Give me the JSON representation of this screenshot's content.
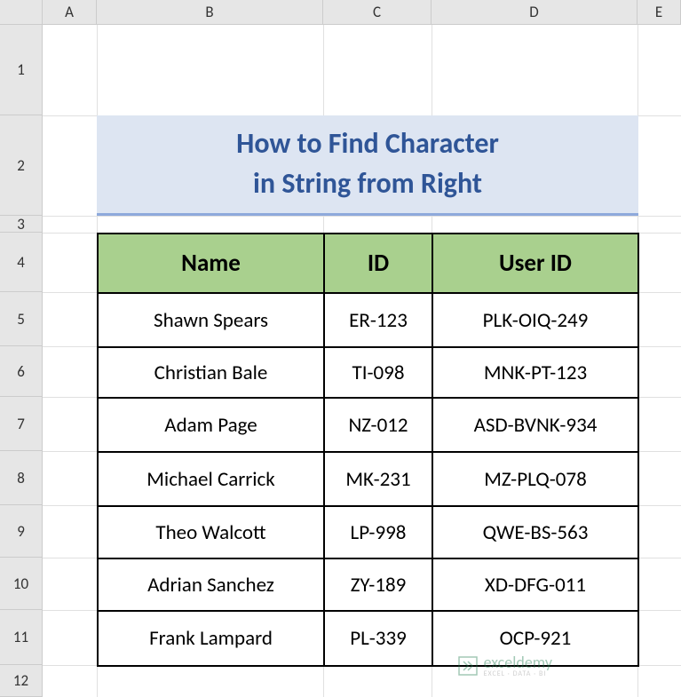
{
  "columnHeaders": {
    "A": "A",
    "B": "B",
    "C": "C",
    "D": "D",
    "E": "E"
  },
  "rowHeaders": {
    "1": "1",
    "2": "2",
    "3": "3",
    "4": "4",
    "5": "5",
    "6": "6",
    "7": "7",
    "8": "8",
    "9": "9",
    "10": "10",
    "11": "11",
    "12": "12"
  },
  "title": {
    "line1": "How to Find Character",
    "line2": "in String from Right"
  },
  "table": {
    "headers": {
      "name": "Name",
      "id": "ID",
      "userId": "User ID"
    },
    "rows": [
      {
        "name": "Shawn Spears",
        "id": "ER-123",
        "userId": "PLK-OIQ-249"
      },
      {
        "name": "Christian Bale",
        "id": "TI-098",
        "userId": "MNK-PT-123"
      },
      {
        "name": "Adam Page",
        "id": "NZ-012",
        "userId": "ASD-BVNK-934"
      },
      {
        "name": "Michael Carrick",
        "id": "MK-231",
        "userId": "MZ-PLQ-078"
      },
      {
        "name": "Theo Walcott",
        "id": "LP-998",
        "userId": "QWE-BS-563"
      },
      {
        "name": "Adrian Sanchez",
        "id": "ZY-189",
        "userId": "XD-DFG-011"
      },
      {
        "name": "Frank Lampard",
        "id": "PL-339",
        "userId": "OCP-921"
      }
    ]
  },
  "watermark": {
    "brand": "exceldemy",
    "sub": "EXCEL · DATA · BI"
  }
}
